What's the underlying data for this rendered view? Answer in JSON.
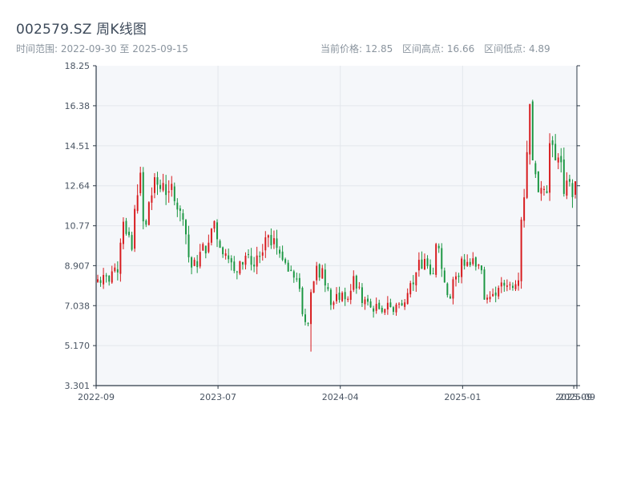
{
  "header": {
    "title": "002579.SZ 周K线图",
    "range_label": "时间范围: 2022-09-30 至 2025-09-15",
    "current_price": "当前价格: 12.85",
    "high": "区间高点: 16.66",
    "low": "区间低点: 4.89"
  },
  "colors": {
    "up": "#d7191c",
    "down": "#1a9641",
    "plot_bg": "#f5f7fa",
    "axis": "#2d3a48",
    "grid": "#e3e7ec"
  },
  "chart_data": {
    "type": "candlestick",
    "title": "002579.SZ 周K线图",
    "ylim": [
      3.301,
      18.25
    ],
    "yticks": [
      "3.301",
      "5.170",
      "7.038",
      "8.907",
      "10.77",
      "12.64",
      "14.51",
      "16.38",
      "18.25"
    ],
    "xlim": [
      "2022-09-30",
      "2025-09-15"
    ],
    "xticks": [
      {
        "date": "2022-09-30",
        "label": "2022-09"
      },
      {
        "date": "2023-07-01",
        "label": "2023-07"
      },
      {
        "date": "2024-04-01",
        "label": "2024-04"
      },
      {
        "date": "2025-01-01",
        "label": "2025-01"
      },
      {
        "date": "2025-09-08",
        "label": "2025-09"
      },
      {
        "date": "2025-09-15",
        "label": "2025-09"
      }
    ],
    "grid": true,
    "anchors": {
      "start": "2022-09-30",
      "end": "2025-09-15",
      "high": 16.66,
      "low": 4.89,
      "last_close": 12.85
    },
    "closes": [
      8.27,
      8.1,
      8.47,
      8.41,
      8.16,
      8.64,
      8.82,
      8.59,
      9.98,
      10.96,
      10.39,
      10.33,
      9.65,
      11.56,
      12.2,
      13.25,
      10.98,
      10.82,
      11.87,
      12.19,
      13.04,
      12.69,
      12.49,
      12.77,
      12.21,
      12.38,
      12.73,
      11.92,
      11.53,
      11.47,
      11.06,
      10.37,
      9.3,
      8.82,
      9.18,
      8.84,
      9.55,
      9.92,
      9.48,
      9.98,
      10.64,
      10.99,
      10.14,
      9.74,
      9.44,
      9.48,
      9.21,
      9.06,
      8.66,
      8.61,
      9.11,
      8.96,
      9.37,
      9.43,
      8.95,
      8.87,
      9.38,
      9.32,
      9.53,
      10.23,
      10.33,
      9.86,
      10.19,
      9.74,
      9.47,
      9.18,
      9.04,
      8.63,
      8.66,
      8.35,
      8.26,
      7.82,
      6.64,
      6.27,
      6.21,
      7.67,
      8.18,
      8.9,
      8.35,
      8.79,
      7.98,
      7.81,
      7.07,
      7.19,
      7.58,
      7.31,
      7.64,
      7.34,
      7.36,
      7.73,
      8.42,
      7.84,
      7.92,
      7.16,
      7.33,
      7.22,
      6.96,
      6.76,
      7.12,
      6.88,
      6.74,
      6.88,
      7.17,
      6.97,
      6.75,
      7.09,
      7.13,
      7.05,
      7.19,
      7.63,
      8.09,
      8.04,
      8.6,
      9.18,
      8.76,
      9.22,
      8.88,
      8.51,
      8.52,
      9.92,
      9.72,
      8.75,
      8.13,
      7.53,
      7.38,
      8.27,
      8.41,
      8.38,
      9.24,
      8.9,
      9.08,
      8.93,
      9.25,
      8.86,
      8.96,
      8.69,
      7.32,
      7.41,
      7.45,
      7.58,
      7.51,
      7.87,
      8.12,
      7.97,
      7.98,
      8.03,
      7.87,
      8.04,
      8.22,
      11.06,
      12.1,
      14.21,
      16.46,
      13.83,
      13.18,
      12.34,
      12.54,
      12.49,
      12.3,
      14.63,
      14.55,
      13.83,
      13.96,
      13.74,
      12.26,
      12.88,
      12.83,
      12.11,
      12.85
    ]
  }
}
